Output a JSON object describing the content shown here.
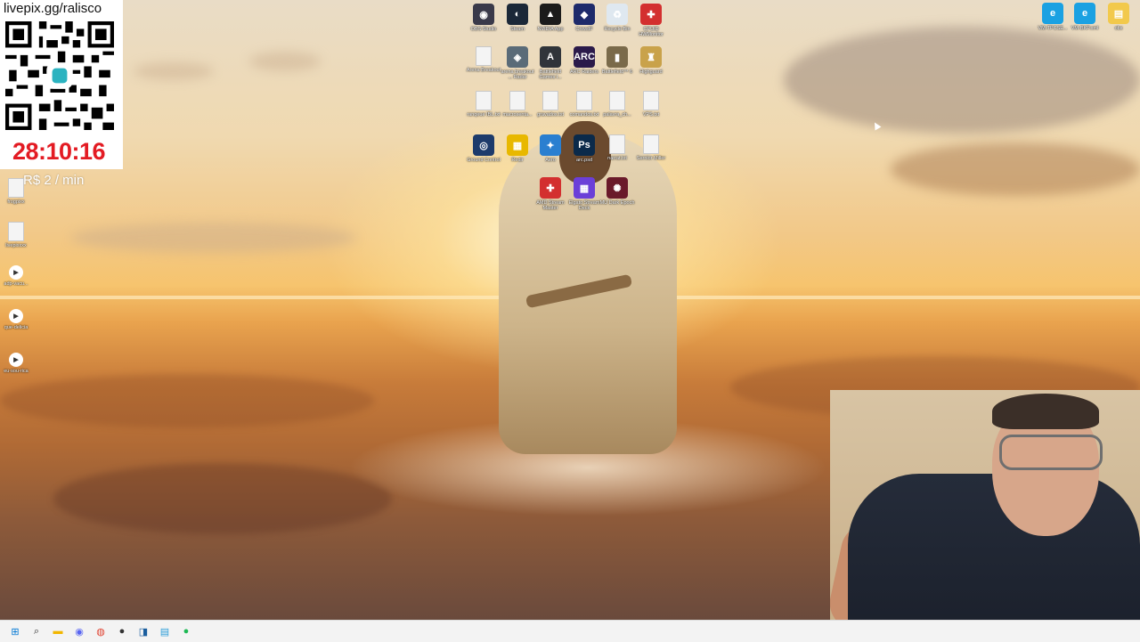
{
  "overlay": {
    "pix_url": "livepix.gg/ralisco",
    "timer": "28:10:16",
    "rate": "R$ 2 / min",
    "timer_color": "#e31b23"
  },
  "desktop_center": [
    [
      {
        "label": "OBS Studio",
        "icon": "obs-icon",
        "color": "#3a3a4a",
        "glyph": "◉"
      },
      {
        "label": "Steam",
        "icon": "steam-icon",
        "color": "#1b2838",
        "glyph": "◐"
      },
      {
        "label": "NVIDIA App",
        "icon": "nvidia-icon",
        "color": "#1b1b1b",
        "glyph": "▲"
      },
      {
        "label": "CrowdF",
        "icon": "crowdf-icon",
        "color": "#1d2a6b",
        "glyph": "◆"
      },
      {
        "label": "Recycle Bin",
        "icon": "recycle-bin-icon",
        "color": "#dfe8f0",
        "glyph": "♻"
      },
      {
        "label": "CPUID HWMonitor",
        "icon": "hwmonitor-icon",
        "color": "#d32f2f",
        "glyph": "✚"
      }
    ],
    [
      {
        "label": "Arena Breakout",
        "icon": "file-icon",
        "color": "doc",
        "glyph": ""
      },
      {
        "label": "arena breakout ... Radar",
        "icon": "arena-radar-icon",
        "color": "#5a6b78",
        "glyph": "◈"
      },
      {
        "label": "Battlefield Games l...",
        "icon": "battlefield-icon",
        "color": "#30343a",
        "glyph": "A"
      },
      {
        "label": "ARC Raiders",
        "icon": "arc-raiders-icon",
        "color": "#2b1a4a",
        "glyph": "ARC"
      },
      {
        "label": "Battlefield™ 6",
        "icon": "battlefield6-icon",
        "color": "#7a6a4a",
        "glyph": "▮"
      },
      {
        "label": "Highguard",
        "icon": "highguard-icon",
        "color": "#c9a24a",
        "glyph": "♜"
      }
    ],
    [
      {
        "label": "ranqeue IBL.txt",
        "icon": "text-file-icon",
        "color": "doc",
        "glyph": ""
      },
      {
        "label": "macrosenta...",
        "icon": "text-file-icon",
        "color": "doc",
        "glyph": ""
      },
      {
        "label": "gravados.txt",
        "icon": "text-file-icon",
        "color": "doc",
        "glyph": ""
      },
      {
        "label": "comandos.txt",
        "icon": "text-file-icon",
        "color": "doc",
        "glyph": ""
      },
      {
        "label": "palavra_ch...",
        "icon": "text-file-icon",
        "color": "doc",
        "glyph": ""
      },
      {
        "label": "VPS.txt",
        "icon": "text-file-icon",
        "color": "doc",
        "glyph": ""
      }
    ],
    [
      {
        "label": "Ground Control",
        "icon": "ground-control-icon",
        "color": "#1d3b6b",
        "glyph": "◎"
      },
      {
        "label": "Redir",
        "icon": "redir-icon",
        "color": "#e8b800",
        "glyph": "▦"
      },
      {
        "label": "Aero",
        "icon": "aero-icon",
        "color": "#2a7fd0",
        "glyph": "✦"
      },
      {
        "label": "arc.psd",
        "icon": "photoshop-icon",
        "color": "#0b2a4a",
        "glyph": "Ps"
      },
      {
        "label": "narrat.txt",
        "icon": "text-file-icon",
        "color": "doc",
        "glyph": ""
      },
      {
        "label": "Sernior Miller",
        "icon": "text-file-icon",
        "color": "doc",
        "glyph": ""
      }
    ],
    [
      {
        "label": "AMD Stream Master",
        "icon": "amd-icon",
        "color": "#d32f2f",
        "glyph": "✚"
      },
      {
        "label": "Elgato Stream Deck",
        "icon": "stream-deck-icon",
        "color": "#6b3fd8",
        "glyph": "▦"
      },
      {
        "label": "MU Dark Epoch",
        "icon": "mu-dark-epoch-icon",
        "color": "#6a1a2a",
        "glyph": "✺"
      }
    ]
  ],
  "desktop_left": [
    {
      "label": "frogpixx",
      "icon": "text-file-icon",
      "kind": "doc"
    },
    {
      "label": "livepixxxx",
      "icon": "text-file-icon",
      "kind": "doc"
    },
    {
      "label": "adp-vacu...",
      "icon": "media-file-icon",
      "kind": "media"
    },
    {
      "label": "que-delicia",
      "icon": "media-file-icon",
      "kind": "media"
    },
    {
      "label": "eu-sou-rica",
      "icon": "media-file-icon",
      "kind": "media"
    }
  ],
  "desktop_right": [
    {
      "label": "VM-TPCSE...",
      "icon": "edge-icon",
      "color": "#1ba1e2",
      "glyph": "e"
    },
    {
      "label": "VM-BKP.xml",
      "icon": "edge-icon",
      "color": "#1ba1e2",
      "glyph": "e"
    },
    {
      "label": "obs",
      "icon": "folder-icon",
      "color": "#f2c94c",
      "glyph": "▤"
    }
  ],
  "taskbar": [
    {
      "name": "start-button",
      "glyph": "⊞",
      "color": "#0078d4"
    },
    {
      "name": "search-button",
      "glyph": "⌕",
      "color": "#333333"
    },
    {
      "name": "file-explorer-button",
      "glyph": "▬",
      "color": "#f2b600"
    },
    {
      "name": "discord-button",
      "glyph": "◉",
      "color": "#5865f2"
    },
    {
      "name": "chrome-button",
      "glyph": "◍",
      "color": "#e0412f"
    },
    {
      "name": "obs-button",
      "glyph": "●",
      "color": "#333333"
    },
    {
      "name": "vscode-button",
      "glyph": "◨",
      "color": "#1b5e9e"
    },
    {
      "name": "notepad-button",
      "glyph": "▤",
      "color": "#2a9dd8"
    },
    {
      "name": "spotify-button",
      "glyph": "●",
      "color": "#1db954"
    }
  ]
}
